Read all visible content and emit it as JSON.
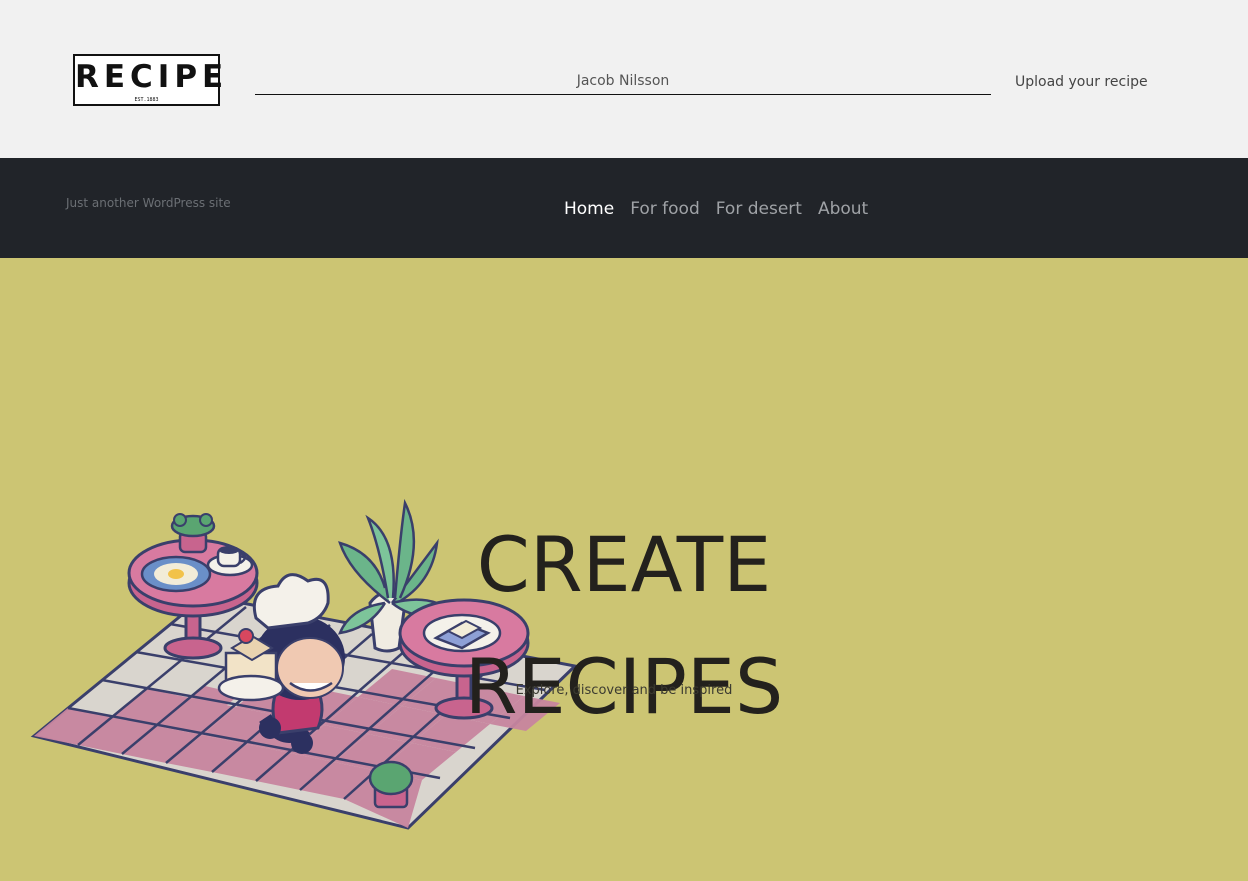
{
  "header": {
    "logo": {
      "text": "RECIPE",
      "sub": "EST.1883"
    },
    "author": "Jacob Nilsson",
    "upload_label": "Upload your recipe"
  },
  "nav": {
    "tagline": "Just another WordPress site",
    "items": [
      {
        "label": "Home",
        "active": true
      },
      {
        "label": "For food",
        "active": false
      },
      {
        "label": "For desert",
        "active": false
      },
      {
        "label": "About",
        "active": false
      }
    ]
  },
  "hero": {
    "title_line1": "CREATE",
    "title_line2": "RECIPES",
    "subtitle": "Explore, discover and be inspired",
    "illustration": "chef-cafe-illustration"
  },
  "colors": {
    "header_bg": "#f1f1f1",
    "nav_bg": "#212429",
    "hero_bg": "#ccc573",
    "accent_pink": "#c8648e"
  }
}
